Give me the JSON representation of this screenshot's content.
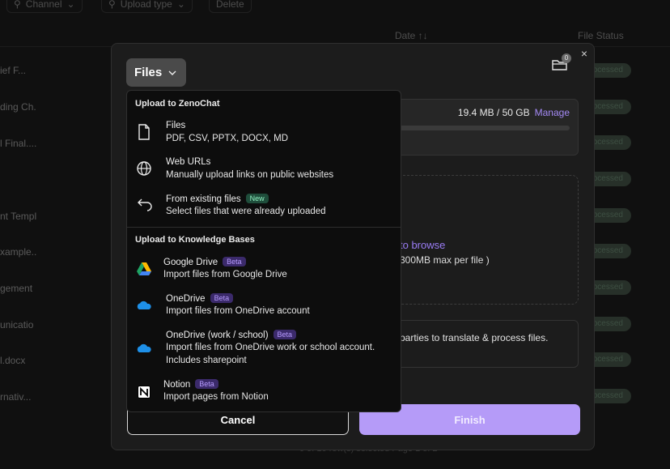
{
  "background": {
    "filters": [
      "Channel",
      "Upload type",
      "Delete"
    ],
    "columns": {
      "date": "Date ↑↓",
      "file_status": "File Status"
    },
    "rows": [
      {
        "name": "ief F...",
        "status": "ocessed"
      },
      {
        "name": "ding Ch.",
        "status": "ocessed"
      },
      {
        "name": "l Final....",
        "status": "ocessed"
      },
      {
        "name": "",
        "status": "ocessed"
      },
      {
        "name": "nt Templ",
        "status": "ocessed"
      },
      {
        "name": "xample..",
        "status": "ocessed"
      },
      {
        "name": "gement",
        "status": "ocessed"
      },
      {
        "name": "unicatio",
        "status": "ocessed"
      },
      {
        "name": "l.docx",
        "status": "ocessed"
      },
      {
        "name": "rnativ...",
        "status": "ocessed"
      }
    ],
    "footer": "0 of 10 row(s) selected  Page 1 of 2"
  },
  "modal": {
    "close_label": "×",
    "folder_count": "0",
    "storage": {
      "used": "19.4 MB / 50 GB",
      "manage_label": "Manage"
    },
    "dropzone": {
      "browse_text": "to browse",
      "max_text": "300MB max per file )"
    },
    "notice_text": "parties to translate & process files.",
    "cancel_label": "Cancel",
    "finish_label": "Finish"
  },
  "dropdown": {
    "trigger_label": "Files",
    "section_zenochat": "Upload to ZenoChat",
    "section_kb": "Upload to Knowledge Bases",
    "zenochat_items": [
      {
        "title": "Files",
        "subtitle": "PDF, CSV, PPTX, DOCX, MD",
        "icon": "file-icon"
      },
      {
        "title": "Web URLs",
        "subtitle": "Manually upload links on public websites",
        "icon": "globe-icon"
      },
      {
        "title": "From existing files",
        "badge": "New",
        "subtitle": "Select files that were already uploaded",
        "icon": "return-arrow-icon"
      }
    ],
    "kb_items": [
      {
        "title": "Google Drive",
        "badge": "Beta",
        "subtitle": "Import files from Google Drive",
        "icon": "google-drive-icon"
      },
      {
        "title": "OneDrive",
        "badge": "Beta",
        "subtitle": "Import files from OneDrive account",
        "icon": "onedrive-icon"
      },
      {
        "title": "OneDrive (work / school)",
        "badge": "Beta",
        "subtitle": "Import files from OneDrive work or school account.",
        "subtitle2": "Includes sharepoint",
        "icon": "onedrive-icon"
      },
      {
        "title": "Notion",
        "badge": "Beta",
        "subtitle": "Import pages from Notion",
        "icon": "notion-icon"
      }
    ]
  },
  "colors": {
    "accent": "#a48af5",
    "finish_bg": "#b59bf8",
    "beta_bg": "#3b2a6b",
    "new_bg": "#1f4d3b"
  }
}
